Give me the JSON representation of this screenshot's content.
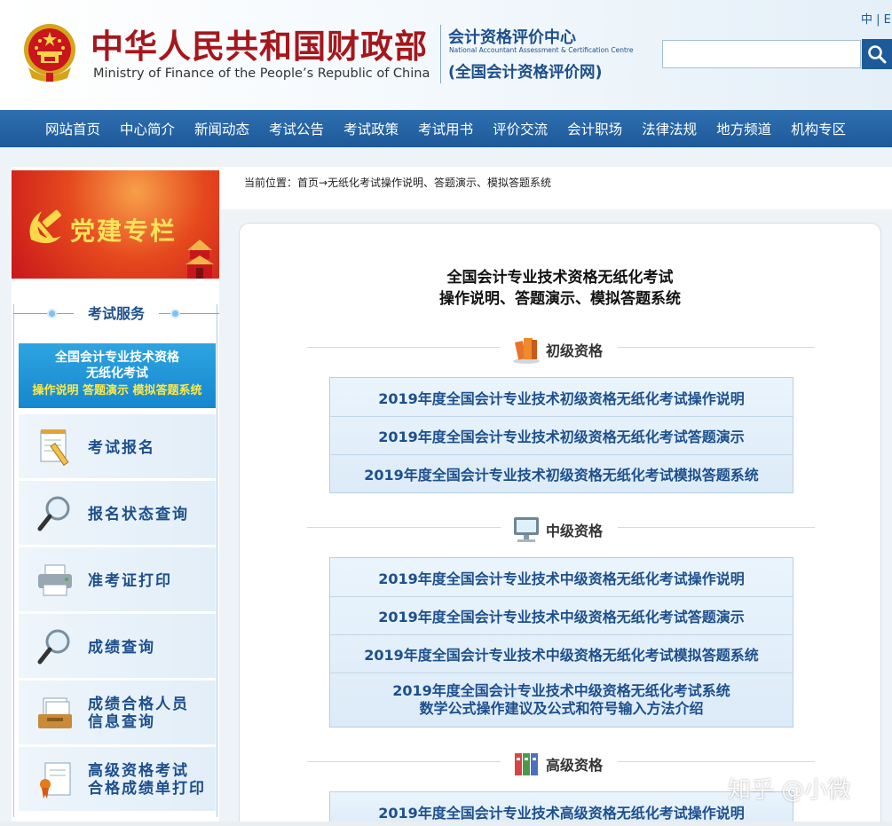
{
  "header": {
    "ministry_cn": "中华人民共和国财政部",
    "ministry_en": "Ministry of Finance of the People’s Republic of China",
    "center_cn": "会计资格评价中心",
    "center_en": "National Accountant Assessment & Certification Centre",
    "site_name": "(全国会计资格评价网)",
    "lang_switch": "中 | E",
    "search_placeholder": "",
    "icons": {
      "emblem": "national-emblem-icon",
      "search": "search-icon"
    },
    "colors": {
      "brand_red": "#a5171c",
      "brand_blue": "#1d5a9a"
    }
  },
  "nav": {
    "items": [
      {
        "label": "网站首页"
      },
      {
        "label": "中心简介"
      },
      {
        "label": "新闻动态"
      },
      {
        "label": "考试公告"
      },
      {
        "label": "考试政策"
      },
      {
        "label": "考试用书"
      },
      {
        "label": "评价交流"
      },
      {
        "label": "会计职场"
      },
      {
        "label": "法律法规"
      },
      {
        "label": "地方频道"
      },
      {
        "label": "机构专区"
      }
    ]
  },
  "sidebar": {
    "party_banner": {
      "title": "党建专栏",
      "icon": "hammer-sickle-icon"
    },
    "exam_service": {
      "title": "考试服务",
      "banner": {
        "line1": "全国会计专业技术资格",
        "line2": "无纸化考试",
        "line3": "操作说明 答题演示 模拟答题系统"
      },
      "items": [
        {
          "line1": "考试报名",
          "line2": "",
          "icon": "notepad-pencil-icon"
        },
        {
          "line1": "报名状态查询",
          "line2": "",
          "icon": "magnifier-icon"
        },
        {
          "line1": "准考证打印",
          "line2": "",
          "icon": "printer-icon"
        },
        {
          "line1": "成绩查询",
          "line2": "",
          "icon": "magnifier-icon"
        },
        {
          "line1": "成绩合格人员",
          "line2": "信息查询",
          "icon": "file-tray-icon"
        },
        {
          "line1": "高级资格考试",
          "line2": "合格成绩单打印",
          "icon": "certificate-icon"
        }
      ]
    }
  },
  "breadcrumb": {
    "text": "当前位置：首页→无纸化考试操作说明、答题演示、模拟答题系统"
  },
  "main": {
    "title_line1": "全国会计专业技术资格无纸化考试",
    "title_line2": "操作说明、答题演示、模拟答题系统",
    "sections": [
      {
        "label": "初级资格",
        "icon": "books-icon",
        "links": [
          {
            "line1": "2019年度全国会计专业技术初级资格无纸化考试操作说明"
          },
          {
            "line1": "2019年度全国会计专业技术初级资格无纸化考试答题演示"
          },
          {
            "line1": "2019年度全国会计专业技术初级资格无纸化考试模拟答题系统"
          }
        ]
      },
      {
        "label": "中级资格",
        "icon": "computer-monitor-icon",
        "links": [
          {
            "line1": "2019年度全国会计专业技术中级资格无纸化考试操作说明"
          },
          {
            "line1": "2019年度全国会计专业技术中级资格无纸化考试答题演示"
          },
          {
            "line1": "2019年度全国会计专业技术中级资格无纸化考试模拟答题系统"
          },
          {
            "line1": "2019年度全国会计专业技术中级资格无纸化考试系统",
            "line2": "数学公式操作建议及公式和符号输入方法介绍"
          }
        ]
      },
      {
        "label": "高级资格",
        "icon": "binders-icon",
        "links": [
          {
            "line1": "2019年度全国会计专业技术高级资格无纸化考试操作说明"
          }
        ]
      }
    ]
  },
  "watermark": "知乎 @小微"
}
